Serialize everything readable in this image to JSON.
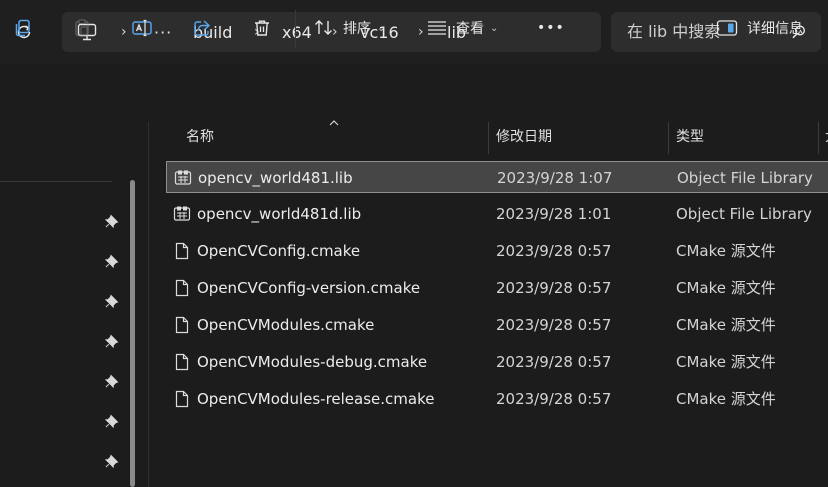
{
  "breadcrumb": {
    "overflow": "···",
    "items": [
      "build",
      "x64",
      "vc16",
      "lib"
    ]
  },
  "search": {
    "placeholder": "在 lib 中搜索"
  },
  "toolbar": {
    "sort_label": "排序",
    "view_label": "查看",
    "more_label": "•••",
    "details_label": "详细信息"
  },
  "columns": {
    "name": "名称",
    "modified": "修改日期",
    "type": "类型",
    "extra": "大"
  },
  "files": [
    {
      "name": "opencv_world481.lib",
      "modified": "2023/9/28 1:07",
      "type": "Object File Library",
      "icon": "lib-file-icon",
      "selected": true
    },
    {
      "name": "opencv_world481d.lib",
      "modified": "2023/9/28 1:01",
      "type": "Object File Library",
      "icon": "lib-file-icon",
      "selected": false
    },
    {
      "name": "OpenCVConfig.cmake",
      "modified": "2023/9/28 0:57",
      "type": "CMake 源文件",
      "icon": "document-icon",
      "selected": false
    },
    {
      "name": "OpenCVConfig-version.cmake",
      "modified": "2023/9/28 0:57",
      "type": "CMake 源文件",
      "icon": "document-icon",
      "selected": false
    },
    {
      "name": "OpenCVModules.cmake",
      "modified": "2023/9/28 0:57",
      "type": "CMake 源文件",
      "icon": "document-icon",
      "selected": false
    },
    {
      "name": "OpenCVModules-debug.cmake",
      "modified": "2023/9/28 0:57",
      "type": "CMake 源文件",
      "icon": "document-icon",
      "selected": false
    },
    {
      "name": "OpenCVModules-release.cmake",
      "modified": "2023/9/28 0:57",
      "type": "CMake 源文件",
      "icon": "document-icon",
      "selected": false
    }
  ],
  "colors": {
    "background": "#1c1c1c",
    "field": "#2d2d2d",
    "selected_row": "#464646"
  }
}
